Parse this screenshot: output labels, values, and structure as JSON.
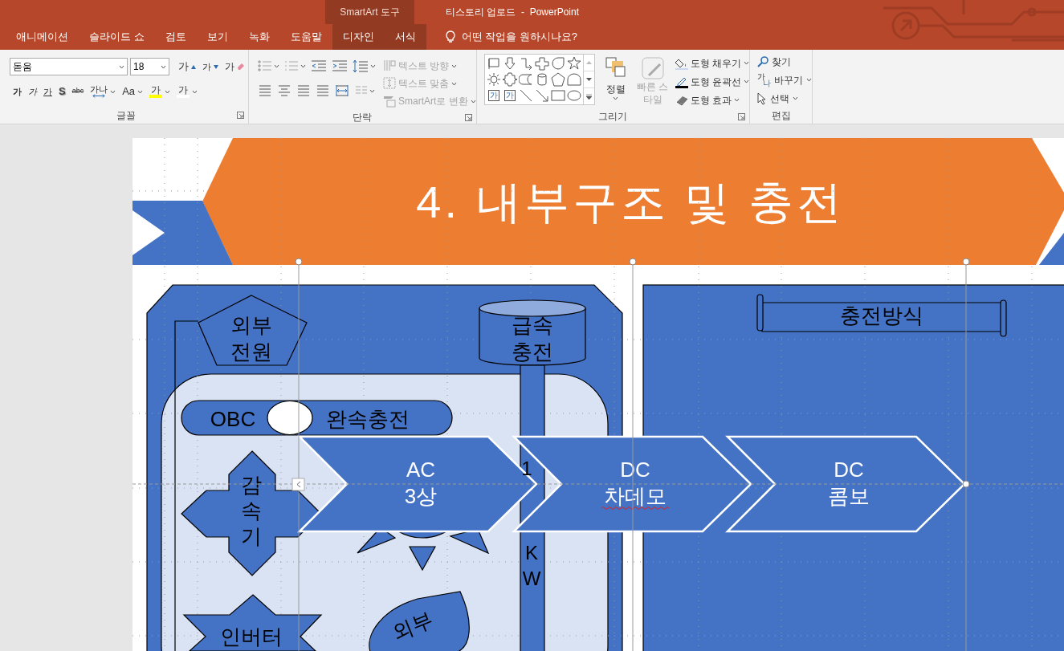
{
  "title_bar": {
    "context_label": "SmartArt 도구",
    "title": "티스토리 업로드  -  PowerPoint"
  },
  "tabs": [
    {
      "label": "애니메이션",
      "selected": false,
      "contextual": false
    },
    {
      "label": "슬라이드 쇼",
      "selected": false,
      "contextual": false
    },
    {
      "label": "검토",
      "selected": false,
      "contextual": false
    },
    {
      "label": "보기",
      "selected": false,
      "contextual": false
    },
    {
      "label": "녹화",
      "selected": false,
      "contextual": false
    },
    {
      "label": "도움말",
      "selected": false,
      "contextual": false
    },
    {
      "label": "디자인",
      "selected": false,
      "contextual": true
    },
    {
      "label": "서식",
      "selected": false,
      "contextual": true
    }
  ],
  "tell_me": {
    "text": "어떤 작업을 원하시나요?"
  },
  "ribbon": {
    "font": {
      "label": "글꼴",
      "font_name": "돋움",
      "font_size": "18",
      "row1": [
        {
          "kind": "grow",
          "text": "가"
        },
        {
          "kind": "shrink",
          "text": "가"
        },
        {
          "kind": "clear",
          "text": "가"
        }
      ],
      "row2": [
        {
          "kind": "bold",
          "text": "가"
        },
        {
          "kind": "italic",
          "text": "가"
        },
        {
          "kind": "underline",
          "text": "가"
        },
        {
          "kind": "shadow",
          "text": "S"
        },
        {
          "kind": "strike",
          "text": "abc"
        },
        {
          "kind": "spacing",
          "text": "가나"
        },
        {
          "kind": "case",
          "text": "Aa"
        },
        {
          "kind": "highlight",
          "text": "가"
        },
        {
          "kind": "color",
          "text": "가"
        }
      ]
    },
    "paragraph": {
      "label": "단락",
      "commands": [
        {
          "label": "텍스트 방향",
          "disabled": true
        },
        {
          "label": "텍스트 맞춤",
          "disabled": true
        },
        {
          "label": "SmartArt로 변환",
          "disabled": true
        }
      ]
    },
    "drawing": {
      "label": "그리기",
      "gallery_glyphs": [
        "가",
        "가"
      ],
      "arrange": "정렬",
      "quick_styles": {
        "label": "빠른 스타일",
        "disabled": true
      },
      "commands": [
        {
          "kind": "fill",
          "label": "도형 채우기"
        },
        {
          "kind": "outline",
          "label": "도형 윤곽선"
        },
        {
          "kind": "effects",
          "label": "도형 효과"
        }
      ]
    },
    "editing": {
      "label": "편집",
      "commands": [
        {
          "kind": "find",
          "label": "찾기"
        },
        {
          "kind": "replace",
          "label": "바꾸기",
          "glyphs": [
            "가",
            "나"
          ]
        },
        {
          "kind": "select",
          "label": "선택"
        }
      ]
    }
  },
  "slide": {
    "title": "4. 내부구조 및 충전",
    "shapes": [
      {
        "kind": "pentagon",
        "lines": [
          "외부",
          "전원"
        ]
      },
      {
        "kind": "cylinder",
        "lines": [
          "급속",
          "충전"
        ]
      },
      {
        "kind": "pill",
        "lines": [
          "OBC",
          "완속충전"
        ]
      },
      {
        "kind": "cross",
        "lines": [
          "감",
          "속",
          "기"
        ]
      },
      {
        "kind": "bar",
        "lines": [
          "1",
          "K",
          "W"
        ]
      },
      {
        "kind": "star",
        "lines": [
          "인버터"
        ]
      },
      {
        "kind": "teardrop",
        "lines": [
          "외부"
        ]
      },
      {
        "kind": "scroll",
        "lines": [
          "충전방식"
        ]
      }
    ],
    "process": [
      {
        "lines": [
          "AC",
          "3상"
        ],
        "misspelled": false
      },
      {
        "lines": [
          "DC",
          "차데모"
        ],
        "misspelled": true
      },
      {
        "lines": [
          "DC",
          "콤보"
        ],
        "misspelled": false
      }
    ]
  }
}
